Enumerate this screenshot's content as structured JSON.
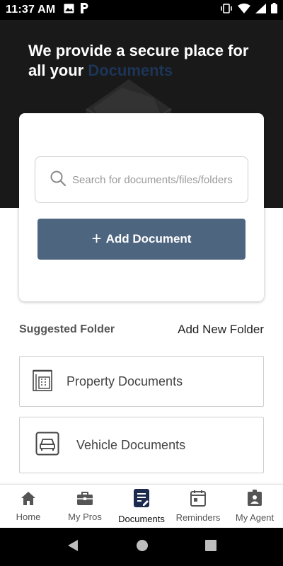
{
  "status_bar": {
    "time": "11:37 AM",
    "icons": [
      "gallery-icon",
      "parking-icon",
      "vibrate-icon",
      "wifi-icon",
      "signal-icon",
      "battery-icon"
    ]
  },
  "hero": {
    "title_part1": "We provide a secure place for all your ",
    "title_accent": "Documents",
    "accent_color": "#1d3557"
  },
  "search": {
    "placeholder": "Search for documents/files/folders"
  },
  "add_document": {
    "plus": "+",
    "label": "Add Document",
    "color": "#4e6580"
  },
  "suggested": {
    "title": "Suggested Folder",
    "add_new_label": "Add New Folder"
  },
  "folders": [
    {
      "label": "Property Documents",
      "icon": "building-icon"
    },
    {
      "label": "Vehicle Documents",
      "icon": "car-icon"
    }
  ],
  "bottom_nav": {
    "items": [
      {
        "label": "Home",
        "icon": "home-icon",
        "active": false
      },
      {
        "label": "My Pros",
        "icon": "briefcase-icon",
        "active": false
      },
      {
        "label": "Documents",
        "icon": "document-icon",
        "active": true
      },
      {
        "label": "Reminders",
        "icon": "calendar-icon",
        "active": false
      },
      {
        "label": "My Agent",
        "icon": "agent-badge-icon",
        "active": false
      }
    ],
    "active_color": "#1d2b4f"
  },
  "system_nav": [
    "back-icon",
    "home-circle-icon",
    "recents-icon"
  ]
}
